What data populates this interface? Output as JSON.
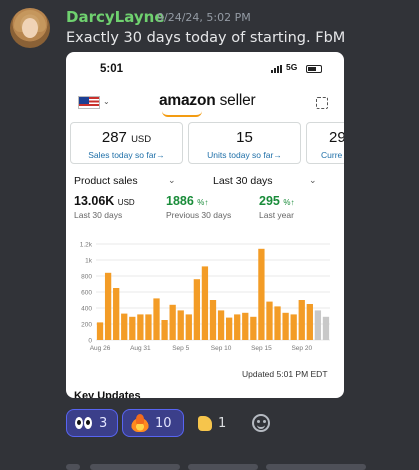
{
  "message": {
    "username": "DarcyLayne",
    "timestamp": "9/24/24, 5:02 PM",
    "text": "Exactly 30 days today of starting. FbM"
  },
  "screenshot": {
    "status_time": "5:01",
    "network": "5G",
    "brand_primary": "amazon",
    "brand_secondary": "seller",
    "cards": [
      {
        "value": "287",
        "unit": "USD",
        "label": "Sales today so far→"
      },
      {
        "value": "15",
        "unit": "",
        "label": "Units today so far→"
      },
      {
        "value": "29",
        "unit": "",
        "label": "Curre"
      }
    ],
    "selector_metric": "Product sales",
    "selector_range": "Last 30 days",
    "metrics": [
      {
        "value": "13.06K",
        "unit": "USD",
        "label": "Last 30 days"
      },
      {
        "value": "1886",
        "unit": "%↑",
        "label": "Previous 30 days"
      },
      {
        "value": "295",
        "unit": "%↑",
        "label": "Last year"
      }
    ],
    "updated": "Updated 5:01 PM EDT",
    "key_updates": "Key Updates",
    "colors": {
      "bar": "#f39c26",
      "bar_pending": "#c8c8c8",
      "link": "#1e6fa8",
      "up": "#1a8c3a"
    }
  },
  "chart_data": {
    "type": "bar",
    "title": "",
    "xlabel": "",
    "ylabel": "",
    "ylim": [
      0,
      1200
    ],
    "y_ticks": [
      "0",
      "200",
      "400",
      "600",
      "800",
      "1k",
      "1.2k"
    ],
    "x_tick_labels": [
      "Aug 26",
      "Aug 31",
      "Sep 5",
      "Sep 10",
      "Sep 15",
      "Sep 20"
    ],
    "values": [
      220,
      840,
      650,
      330,
      290,
      320,
      320,
      520,
      250,
      440,
      370,
      320,
      760,
      920,
      500,
      370,
      280,
      320,
      340,
      290,
      1140,
      480,
      420,
      340,
      320,
      500,
      450,
      370,
      290
    ],
    "pending_from_index": 27
  },
  "reactions": [
    {
      "icon": "eyes-icon",
      "count": "3",
      "active": true
    },
    {
      "icon": "fire-icon",
      "count": "10",
      "active": true
    },
    {
      "icon": "thumbs-up-icon",
      "count": "1",
      "active": false
    }
  ]
}
